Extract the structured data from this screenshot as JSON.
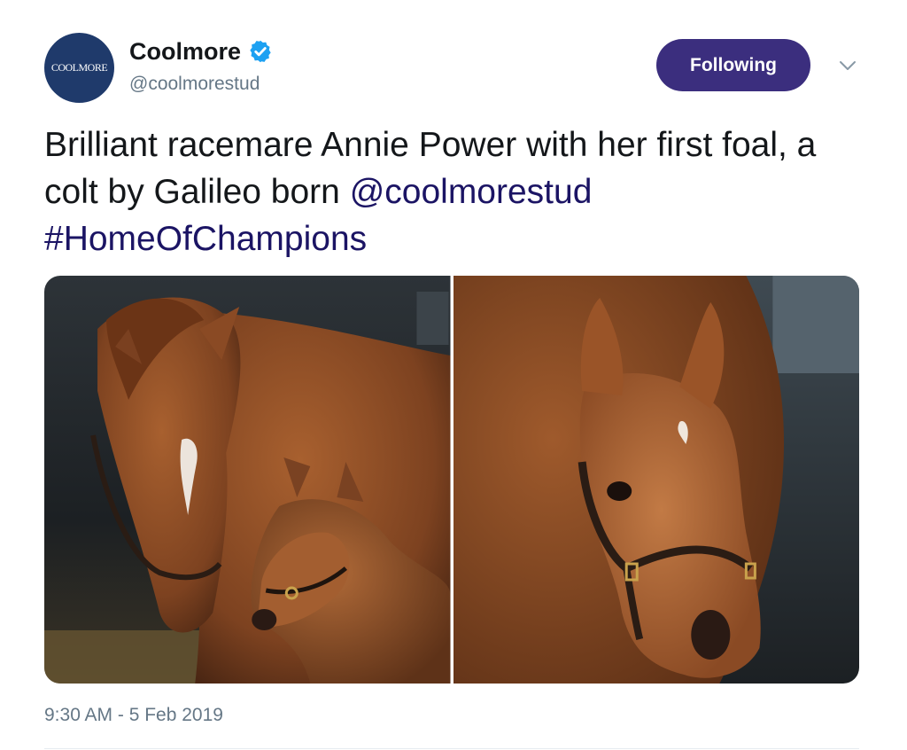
{
  "author": {
    "name": "Coolmore",
    "handle": "@coolmorestud",
    "avatar_text": "COOLMORE",
    "verified": true
  },
  "follow_button": {
    "label": "Following"
  },
  "menu": {
    "icon": "chevron-down-icon"
  },
  "tweet": {
    "text_before": "Brilliant racemare Annie Power with her first foal, a colt by Galileo born ",
    "mention": "@coolmorestud",
    "hashtag": "#HomeOfChampions"
  },
  "media": {
    "photos": [
      {
        "subject": "mare and foal in stable"
      },
      {
        "subject": "foal close-up"
      }
    ]
  },
  "timestamp": "9:30 AM - 5 Feb 2019",
  "colors": {
    "follow_button": "#3b2e7e",
    "link": "#1b1464",
    "verified": "#1da1f2",
    "muted": "#657786"
  }
}
